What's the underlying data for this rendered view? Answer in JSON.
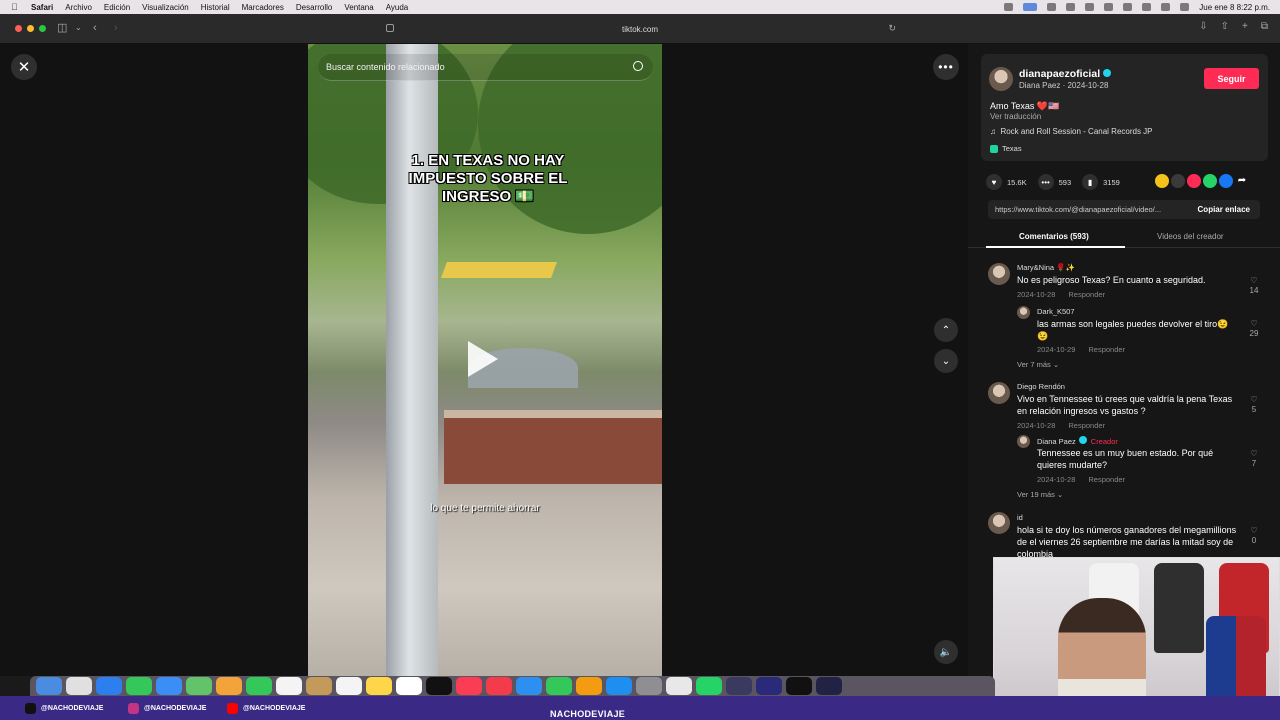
{
  "menubar": {
    "app": "Safari",
    "items": [
      "Archivo",
      "Edición",
      "Visualización",
      "Historial",
      "Marcadores",
      "Desarrollo",
      "Ventana",
      "Ayuda"
    ],
    "datetime": "Jue ene 8  8:22 p.m."
  },
  "browser": {
    "url": "tiktok.com"
  },
  "video": {
    "search_placeholder": "Buscar contenido relacionado",
    "caption": "1. EN TEXAS NO HAY IMPUESTO SOBRE EL INGRESO 💵",
    "subtitle": "lo que te permite ahorrar"
  },
  "post": {
    "author_handle": "dianapaezoficial",
    "author_name": "Diana  Paez",
    "date": "2024-10-28",
    "follow_label": "Seguir",
    "description": "Amo Texas ❤️🇺🇸",
    "translate_label": "Ver traducción",
    "music": "Rock and Roll Session - Canal Records JP",
    "location": "Texas",
    "likes": "15.6K",
    "comments": "593",
    "saves": "3159",
    "link": "https://www.tiktok.com/@dianapaezoficial/video/...",
    "copy_link_label": "Copiar enlace"
  },
  "tabs": {
    "comments": "Comentarios (593)",
    "creator_videos": "Videos del creador"
  },
  "reply_label": "Responder",
  "comments": [
    {
      "user": "Mary&Nina 🌹✨",
      "text": "No es peligroso Texas? En cuanto a seguridad.",
      "date": "2024-10-28",
      "likes": "14",
      "replies": [
        {
          "user": "Dark_K507",
          "text": "las armas son legales puedes devolver el tiro😉😉",
          "date": "2024-10-29",
          "likes": "29"
        }
      ],
      "more": "Ver 7 más ⌄"
    },
    {
      "user": "Diego Rendón",
      "text": "Vivo en Tennessee tú crees que valdría la pena Texas en relación ingresos vs gastos ?",
      "date": "2024-10-28",
      "likes": "5",
      "replies": [
        {
          "user": "Diana  Paez",
          "creator_tag": "Creador",
          "text": "Tennessee es un muy buen estado. Por qué quieres mudarte?",
          "date": "2024-10-28",
          "likes": "7"
        }
      ],
      "more": "Ver 19 más ⌄"
    },
    {
      "user": "id",
      "text": "hola si te doy los números ganadores del megamillions de el viernes 26 septiembre me darías la mitad soy de colombia",
      "likes": "0"
    }
  ],
  "social": {
    "tiktok": "@NACHODEVIAJE",
    "instagram": "@NACHODEVIAJE",
    "youtube": "@NACHODEVIAJE",
    "brand": "NACHODEVIAJE"
  }
}
